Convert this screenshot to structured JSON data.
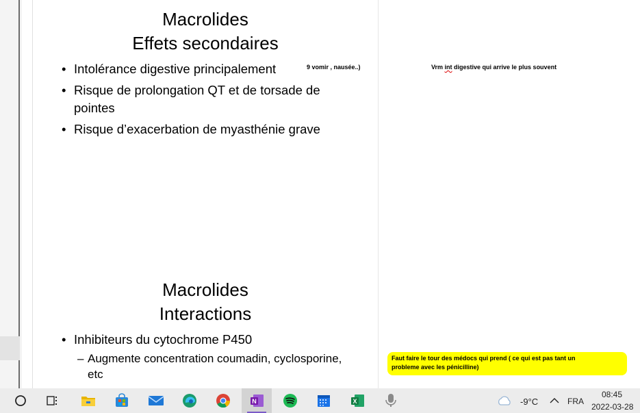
{
  "slides": {
    "slide1": {
      "title_line1": "Macrolides",
      "title_line2": "Effets secondaires",
      "bullets": [
        "Intolérance digestive principalement",
        "Risque de prolongation QT et de torsade de",
        "pointes",
        "Risque d’exacerbation de myasthénie grave"
      ],
      "inline_note": "9 vomir , nausée..)"
    },
    "slide2": {
      "title_line1": "Macrolides",
      "title_line2": "Interactions",
      "bullet1": "Inhibiteurs du cytochrome P450",
      "sub_line1": "Augmente concentration coumadin, cyclosporine,",
      "sub_line2": "etc"
    }
  },
  "notes": {
    "note1_a": "Vrm ",
    "note1_b": "int",
    "note1_c": " digestive qui arrive le plus souvent",
    "note2": "Faut faire le tour des médocs qui prend ( ce qui est pas tant un probleme avec les pénicilline)"
  },
  "taskbar": {
    "apps": [
      "start-icon",
      "task-view-icon",
      "file-explorer-icon",
      "store-icon",
      "mail-icon",
      "edge-icon",
      "chrome-icon",
      "onenote-icon",
      "spotify-icon",
      "calendar-icon",
      "excel-icon",
      "voice-recorder-icon"
    ],
    "weather": "-9°C",
    "language": "FRA",
    "time": "08:45",
    "date": "2022-03-28"
  }
}
